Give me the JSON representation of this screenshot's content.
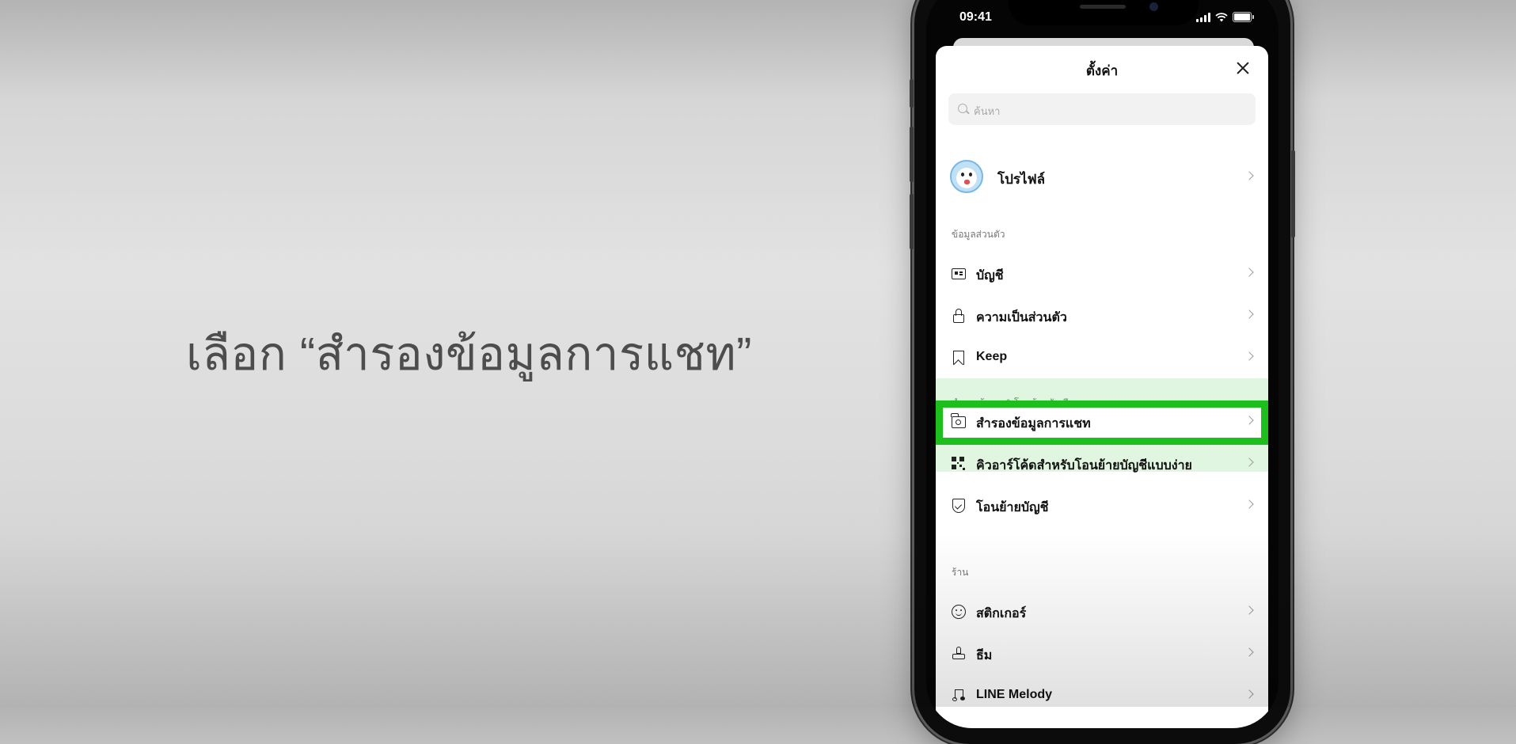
{
  "caption": "เลือก “สำรองข้อมูลการแชท”",
  "status_bar": {
    "time": "09:41"
  },
  "sheet": {
    "title": "ตั้งค่า",
    "search_placeholder": "ค้นหา"
  },
  "profile": {
    "label": "โปรไฟล์"
  },
  "sections": {
    "personal": {
      "title": "ข้อมูลส่วนตัว",
      "items": [
        {
          "label": "บัญชี",
          "icon": "id-card-icon"
        },
        {
          "label": "ความเป็นส่วนตัว",
          "icon": "lock-icon"
        },
        {
          "label": "Keep",
          "icon": "bookmark-icon"
        }
      ]
    },
    "backup": {
      "title": "สำรองข้อมูล & โอนย้ายบัญชี",
      "items": [
        {
          "label": "สำรองข้อมูลการแชท",
          "icon": "folder-icon",
          "highlighted": true
        },
        {
          "label": "คิวอาร์โค้ดสำหรับโอนย้ายบัญชีแบบง่าย",
          "icon": "qr-code-icon"
        },
        {
          "label": "โอนย้ายบัญชี",
          "icon": "shield-check-icon"
        }
      ]
    },
    "shop": {
      "title": "ร้าน",
      "items": [
        {
          "label": "สติกเกอร์",
          "icon": "smile-icon"
        },
        {
          "label": "ธีม",
          "icon": "stamp-icon"
        },
        {
          "label": "LINE Melody",
          "icon": "music-note-icon"
        }
      ]
    }
  },
  "colors": {
    "highlight": "#1dbf1d"
  }
}
